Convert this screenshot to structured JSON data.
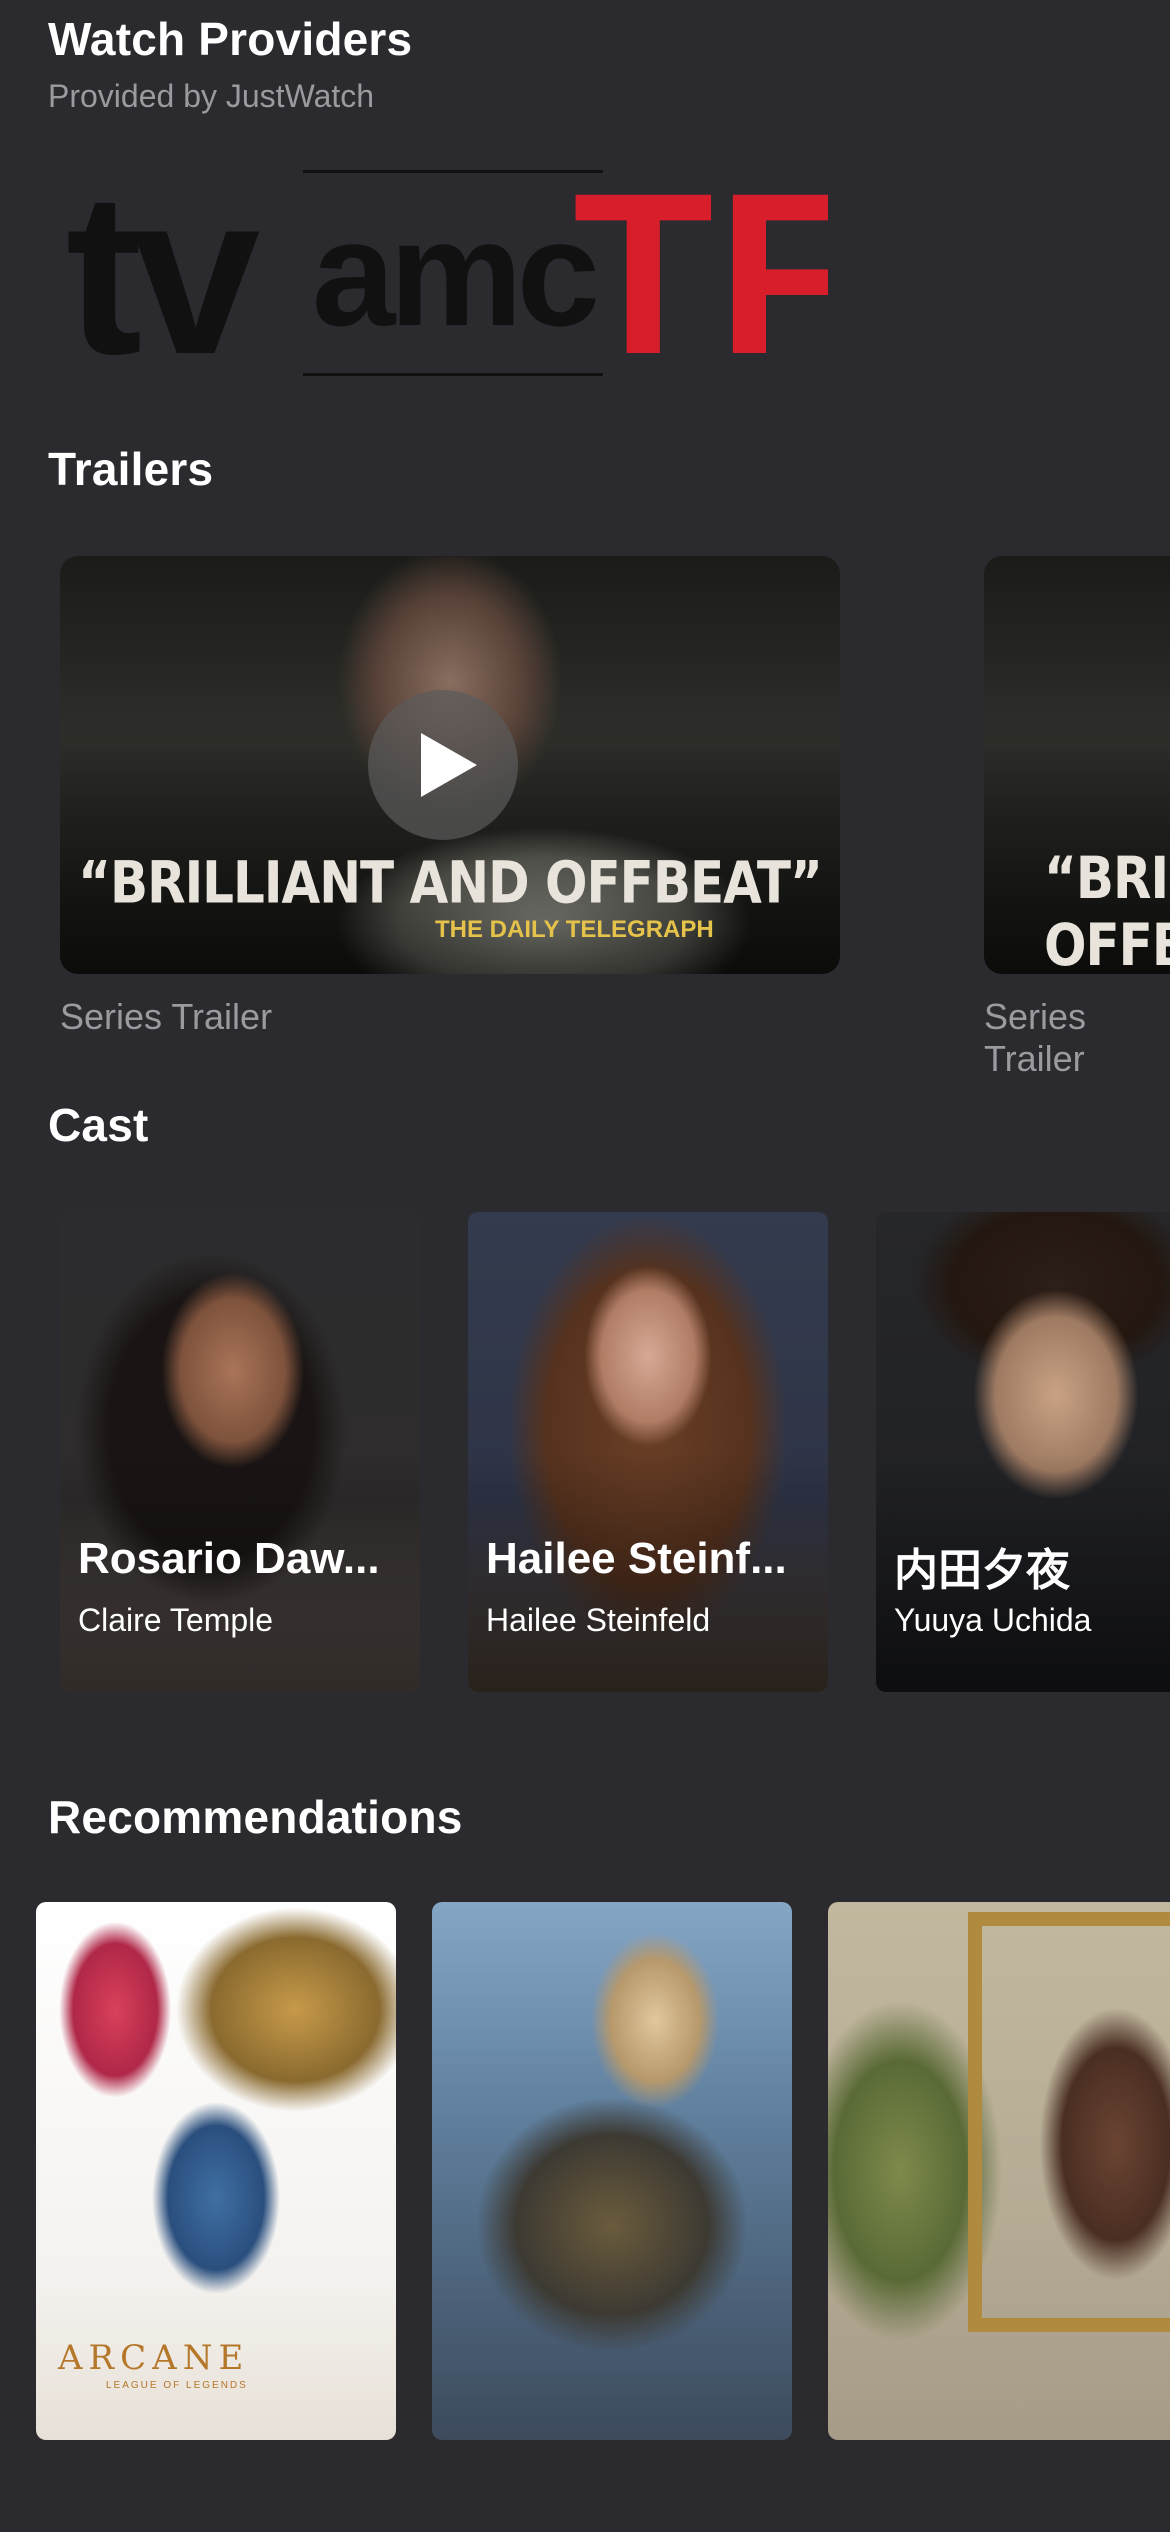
{
  "watch_providers": {
    "title": "Watch Providers",
    "subtitle": "Provided by JustWatch",
    "providers": [
      {
        "logo_text": "tv",
        "color": "#111111"
      },
      {
        "logo_text": "amc",
        "color": "#111111"
      },
      {
        "logo_text": "TFI",
        "color": "#d91e2b"
      }
    ]
  },
  "trailers": {
    "title": "Trailers",
    "items": [
      {
        "label": "Series Trailer",
        "quote": "“BRILLIANT AND OFFBEAT”",
        "source": "THE DAILY TELEGRAPH",
        "play_icon": "play-icon"
      },
      {
        "label": "Series Trailer",
        "quote": "“BRILLIANT AND OFFBEAT”"
      }
    ]
  },
  "cast": {
    "title": "Cast",
    "items": [
      {
        "name": "Rosario Daw...",
        "role": "Claire Temple"
      },
      {
        "name": "Hailee Steinf...",
        "role": "Hailee Steinfeld"
      },
      {
        "name": "内田夕夜",
        "role": "Yuuya Uchida"
      }
    ]
  },
  "recommendations": {
    "title": "Recommendations",
    "items": [
      {
        "poster_text": "ARCANE",
        "poster_subtext": "LEAGUE OF LEGENDS"
      },
      {
        "poster_text": ""
      },
      {
        "poster_text": ""
      }
    ]
  }
}
